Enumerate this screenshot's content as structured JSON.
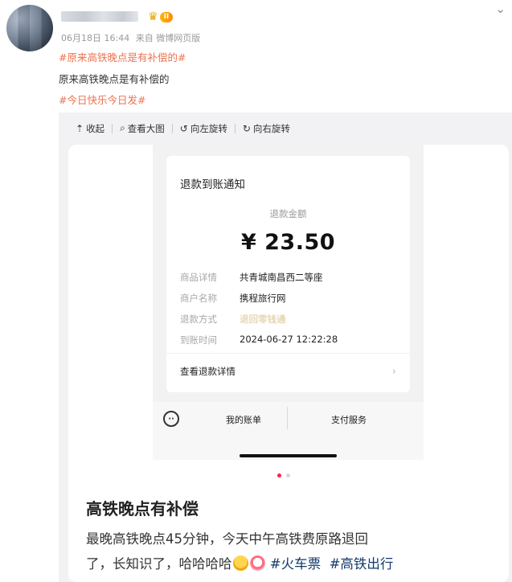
{
  "post": {
    "date": "06月18日 16:44",
    "source": "来自 微博网页版",
    "topic1": "#原来高铁晚点是有补偿的#",
    "text": "原来高铁晚点是有补偿的",
    "topic2": "#今日快乐今日发#",
    "vip_crown": "♛",
    "vip_level": "II"
  },
  "toolbar": {
    "collapse": "收起",
    "view_large": "查看大图",
    "rotate_left": "向左旋转",
    "rotate_right": "向右旋转"
  },
  "refund": {
    "title": "退款到账通知",
    "amount_label": "退款金额",
    "amount": "¥ 23.50",
    "rows": [
      {
        "key": "商品详情",
        "value": "共青城南昌西二等座"
      },
      {
        "key": "商户名称",
        "value": "携程旅行网"
      },
      {
        "key": "退款方式",
        "value": "退回零钱通"
      },
      {
        "key": "到账时间",
        "value": "2024-06-27 12:22:28"
      }
    ],
    "detail_link": "查看退款详情",
    "bottom_left": "我的账单",
    "bottom_right": "支付服务"
  },
  "note": {
    "title": "高铁晚点有补偿",
    "body_line1": "最晚高铁晚点45分钟，今天中午高铁费原路退回",
    "body_line2_a": "了，长知识了，哈哈哈哈",
    "hashtag1": "#火车票",
    "hashtag2": "#高铁出行"
  },
  "colors": {
    "topic": "#eb7350",
    "hashtag": "#13386c",
    "carousel_active": "#ff2442"
  }
}
